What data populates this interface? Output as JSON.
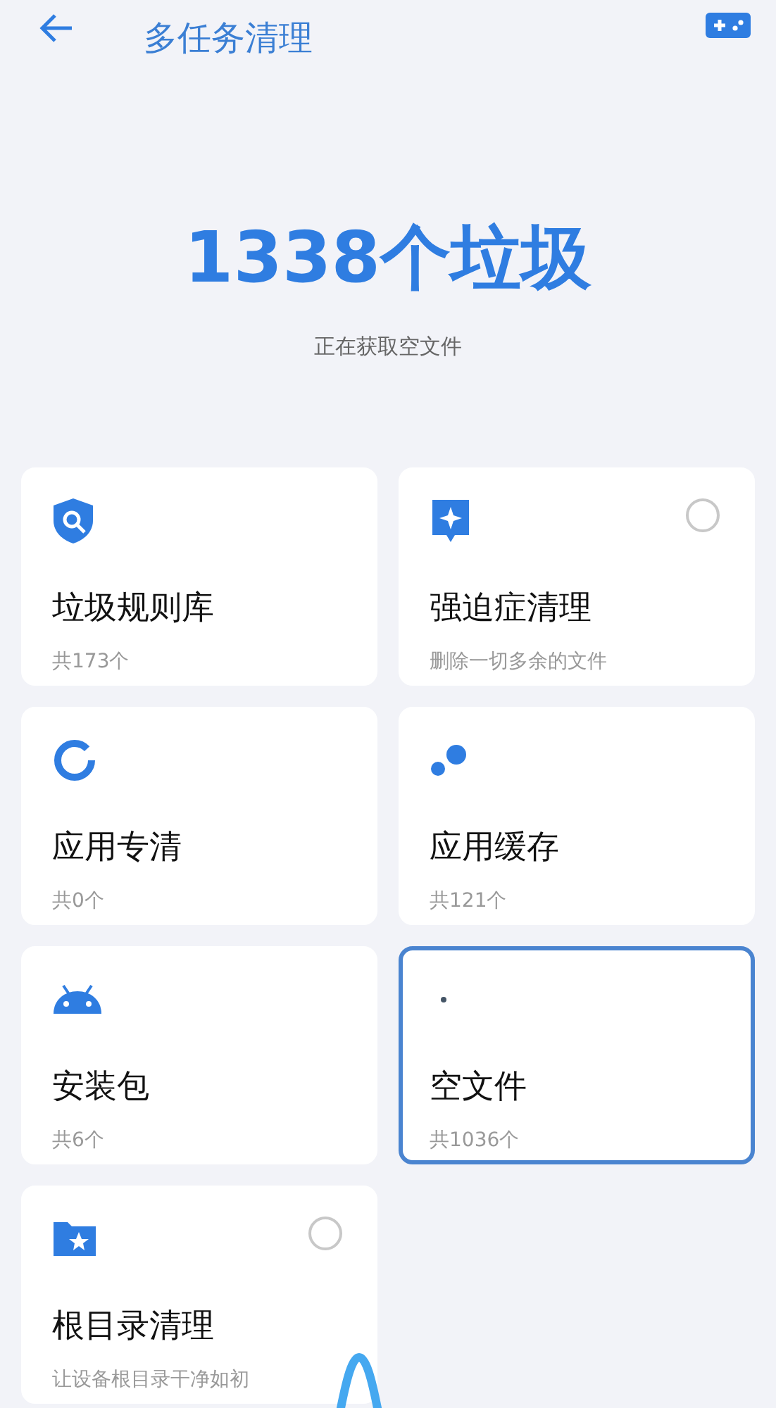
{
  "header": {
    "title": "多任务清理"
  },
  "summary": {
    "headline": "1338个垃圾",
    "status": "正在获取空文件"
  },
  "cards": [
    {
      "kind": "shield",
      "title": "垃圾规则库",
      "subtitle": "共173个",
      "selectable": false,
      "highlighted": false
    },
    {
      "kind": "sparkle",
      "title": "强迫症清理",
      "subtitle": "删除一切多余的文件",
      "selectable": true,
      "checked": false,
      "highlighted": false
    },
    {
      "kind": "ring",
      "title": "应用专清",
      "subtitle": "共0个",
      "selectable": false,
      "highlighted": false
    },
    {
      "kind": "bubbles",
      "title": "应用缓存",
      "subtitle": "共121个",
      "selectable": false,
      "highlighted": false
    },
    {
      "kind": "android",
      "title": "安装包",
      "subtitle": "共6个",
      "selectable": false,
      "highlighted": false
    },
    {
      "kind": "dot",
      "title": "空文件",
      "subtitle": "共1036个",
      "selectable": false,
      "highlighted": true
    },
    {
      "kind": "folder",
      "title": "根目录清理",
      "subtitle": "让设备根目录干净如初",
      "selectable": true,
      "checked": false,
      "highlighted": false
    }
  ]
}
